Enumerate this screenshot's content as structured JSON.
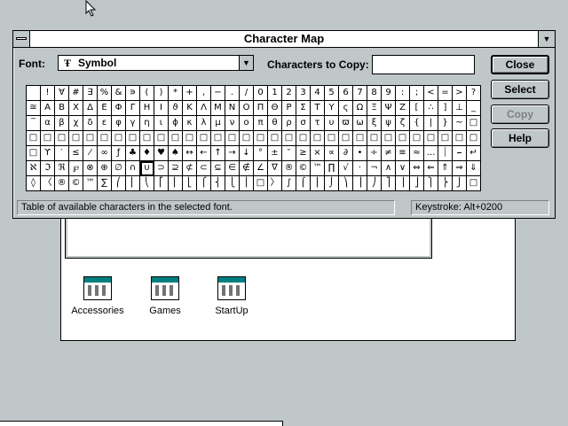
{
  "window": {
    "title": "Character Map",
    "max_glyph": "▼",
    "font_label": "Font:",
    "font_value": "Symbol",
    "font_glyph": "Ŧ",
    "dropdown_glyph": "▼",
    "copy_label": "Characters to Copy:",
    "copy_value": "",
    "buttons": {
      "close": "Close",
      "select": "Select",
      "copy": "Copy",
      "help": "Help"
    },
    "status_text": "Table of available characters in the selected font.",
    "keystroke": "Keystroke: Alt+0200"
  },
  "charmap": {
    "rows": [
      [
        " ",
        "!",
        "∀",
        "#",
        "∃",
        "%",
        "&",
        "∍",
        "(",
        ")",
        "*",
        "+",
        ",",
        "−",
        ".",
        "/",
        "0",
        "1",
        "2",
        "3",
        "4",
        "5",
        "6",
        "7",
        "8",
        "9",
        ":",
        ";",
        "<",
        "=",
        ">",
        "?"
      ],
      [
        "≅",
        "Α",
        "Β",
        "Χ",
        "Δ",
        "Ε",
        "Φ",
        "Γ",
        "Η",
        "Ι",
        "ϑ",
        "Κ",
        "Λ",
        "Μ",
        "Ν",
        "Ο",
        "Π",
        "Θ",
        "Ρ",
        "Σ",
        "Τ",
        "Υ",
        "ς",
        "Ω",
        "Ξ",
        "Ψ",
        "Ζ",
        "[",
        "∴",
        "]",
        "⊥",
        "_"
      ],
      [
        "‾",
        "α",
        "β",
        "χ",
        "δ",
        "ε",
        "φ",
        "γ",
        "η",
        "ι",
        "ϕ",
        "κ",
        "λ",
        "μ",
        "ν",
        "ο",
        "π",
        "θ",
        "ρ",
        "σ",
        "τ",
        "υ",
        "ϖ",
        "ω",
        "ξ",
        "ψ",
        "ζ",
        "{",
        "|",
        "}",
        "~",
        "□"
      ],
      [
        "□",
        "□",
        "□",
        "□",
        "□",
        "□",
        "□",
        "□",
        "□",
        "□",
        "□",
        "□",
        "□",
        "□",
        "□",
        "□",
        "□",
        "□",
        "□",
        "□",
        "□",
        "□",
        "□",
        "□",
        "□",
        "□",
        "□",
        "□",
        "□",
        "□",
        "□",
        "□"
      ],
      [
        "□",
        "ϒ",
        "′",
        "≤",
        "⁄",
        "∞",
        "ƒ",
        "♣",
        "♦",
        "♥",
        "♠",
        "↔",
        "←",
        "↑",
        "→",
        "↓",
        "°",
        "±",
        "″",
        "≥",
        "×",
        "∝",
        "∂",
        "•",
        "÷",
        "≠",
        "≡",
        "≈",
        "…",
        "⏐",
        "⎯",
        "↵"
      ],
      [
        "ℵ",
        "ℑ",
        "ℜ",
        "℘",
        "⊗",
        "⊕",
        "∅",
        "∩",
        "∪",
        "⊃",
        "⊇",
        "⊄",
        "⊂",
        "⊆",
        "∈",
        "∉",
        "∠",
        "∇",
        "®",
        "©",
        "™",
        "∏",
        "√",
        "⋅",
        "¬",
        "∧",
        "∨",
        "⇔",
        "⇐",
        "⇑",
        "⇒",
        "⇓"
      ],
      [
        "◊",
        "〈",
        "®",
        "©",
        "™",
        "∑",
        "⎛",
        "⎜",
        "⎝",
        "⎡",
        "⎢",
        "⎣",
        "⎧",
        "⎨",
        "⎩",
        "⎪",
        "□",
        "〉",
        "∫",
        "⌠",
        "⎮",
        "⌡",
        "⎞",
        "⎟",
        "⎠",
        "⎤",
        "⎥",
        "⎦",
        "⎫",
        "⎬",
        "⎭",
        "□"
      ]
    ],
    "selected": {
      "row": 5,
      "col": 8
    }
  },
  "program_manager": {
    "icons": [
      {
        "label": "Accessories"
      },
      {
        "label": "Games"
      },
      {
        "label": "StartUp"
      }
    ]
  }
}
